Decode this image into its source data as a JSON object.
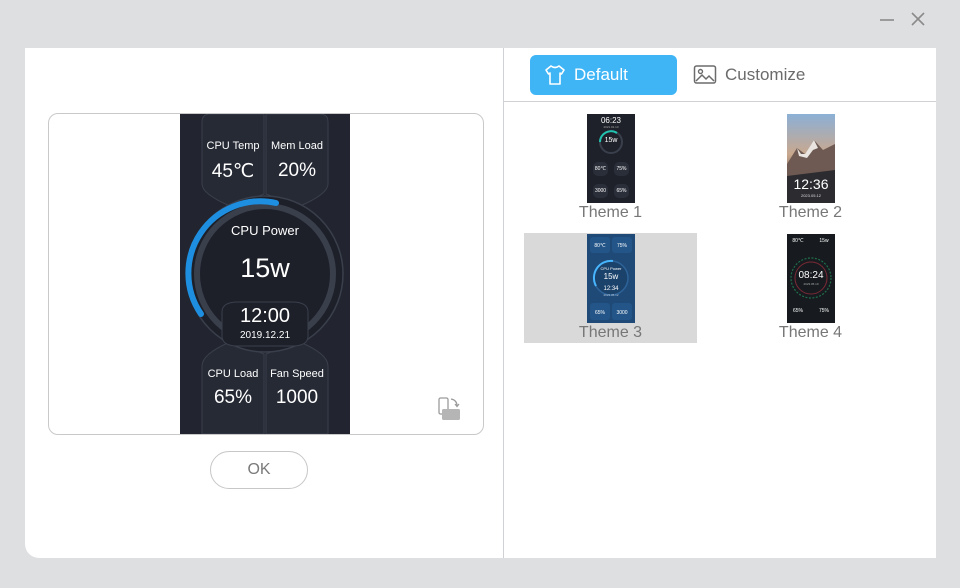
{
  "window": {
    "minimize_icon": "minimize-icon",
    "close_icon": "close-icon"
  },
  "preview": {
    "cpu_temp_label": "CPU Temp",
    "cpu_temp_value": "45℃",
    "mem_load_label": "Mem Load",
    "mem_load_value": "20%",
    "cpu_power_label": "CPU Power",
    "cpu_power_value": "15w",
    "time": "12:00",
    "date": "2019.12.21",
    "cpu_load_label": "CPU Load",
    "cpu_load_value": "65%",
    "fan_speed_label": "Fan Speed",
    "fan_speed_value": "1000",
    "rotate_icon": "rotate-screen-icon",
    "ok_label": "OK"
  },
  "tabs": {
    "default_label": "Default",
    "default_icon": "shirt-icon",
    "customize_label": "Customize",
    "customize_icon": "image-icon"
  },
  "themes": [
    {
      "label": "Theme 1",
      "time": "06:23",
      "date": "2021.01.13",
      "power": "15w",
      "vals": [
        "80℃",
        "75%",
        "3000",
        "65%"
      ]
    },
    {
      "label": "Theme 2",
      "time": "12:36",
      "date": "2023.05.12"
    },
    {
      "label": "Theme 3",
      "power_label": "CPU Power",
      "power": "15w",
      "time": "12:34",
      "date": "2023.05.12",
      "vals": [
        "80℃",
        "75%",
        "65%",
        "3000"
      ]
    },
    {
      "label": "Theme 4",
      "time": "08:24",
      "date": "2023.05.19",
      "vals": [
        "80℃",
        "15w",
        "65%",
        "75%"
      ]
    }
  ],
  "colors": {
    "accent": "#3fb5f6",
    "screen_bg": "#22252f",
    "gauge_arc": "#1e8fe0"
  }
}
